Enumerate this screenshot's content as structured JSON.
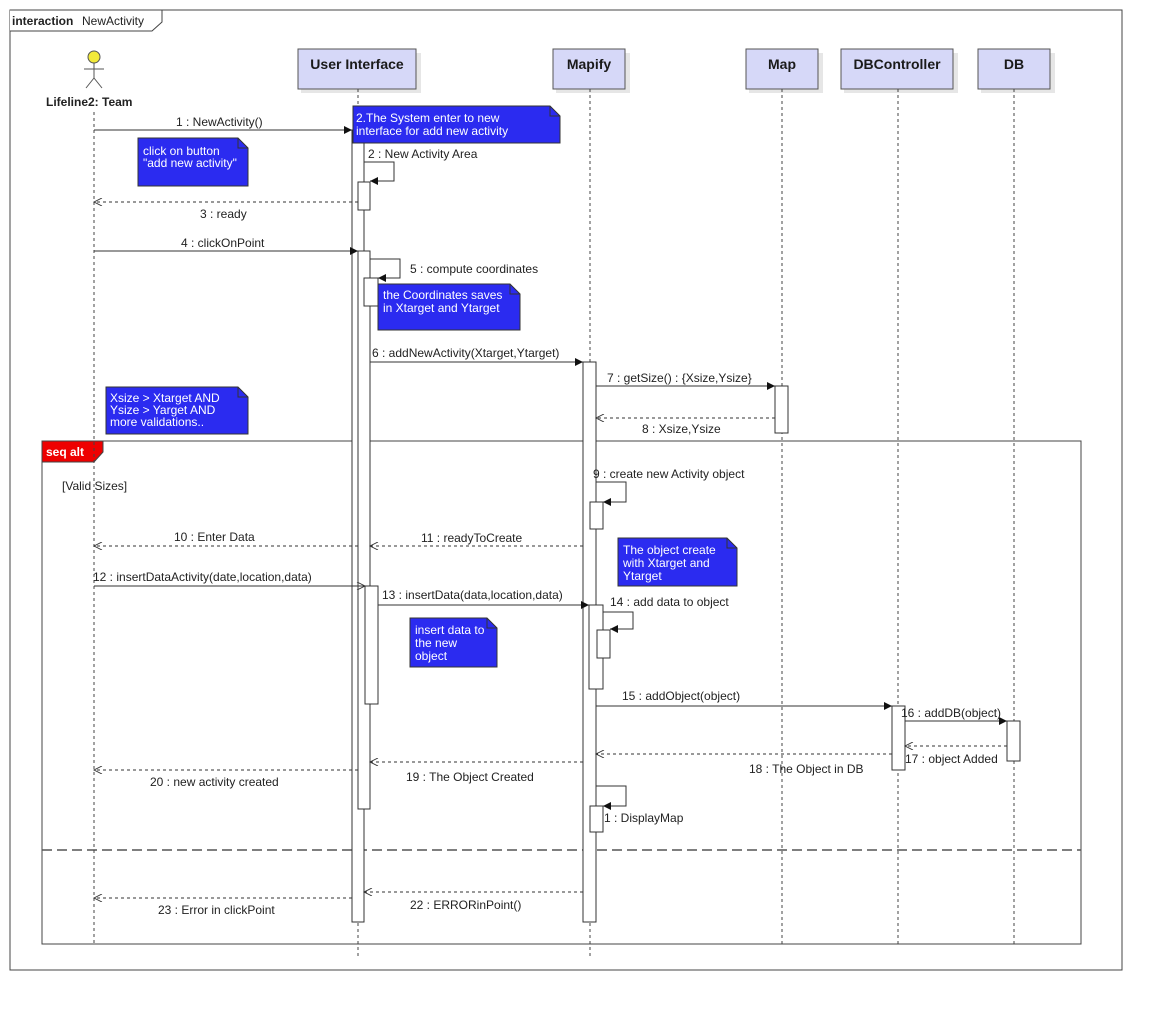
{
  "frame": {
    "keyword": "interaction",
    "name": "NewActivity"
  },
  "actor": {
    "label": "Lifeline2: Team"
  },
  "lifelines": {
    "ui": "User Interface",
    "mapify": "Mapify",
    "map": "Map",
    "dbcontroller": "DBController",
    "db": "DB"
  },
  "fragment": {
    "tag": "seq alt",
    "guard": "[Valid Sizes]"
  },
  "messages": {
    "m1": "1 : NewActivity()",
    "m2": "2 : New Activity Area",
    "m3": "3 : ready",
    "m4": "4 : clickOnPoint",
    "m5": "5 : compute coordinates",
    "m6": "6 : addNewActivity(Xtarget,Ytarget)",
    "m7": "7 : getSize() : {Xsize,Ysize}",
    "m8": "8 : Xsize,Ysize",
    "m9": "9 : create new Activity object",
    "m10": "10 : Enter Data",
    "m11": "11 : readyToCreate",
    "m12": "12 : insertDataActivity(date,location,data)",
    "m13": "13 : insertData(data,location,data)",
    "m14": "14 : add data to object",
    "m15": "15 : addObject(object)",
    "m16": "16 : addDB(object)",
    "m17": "17 : object Added",
    "m18": "18 : The Object in DB",
    "m19": "19 : The Object Created",
    "m20": "20 : new activity created",
    "m21": "1 : DisplayMap",
    "m22": "22 : ERRORinPoint()",
    "m23": "23 : Error in clickPoint"
  },
  "notes": {
    "n1": [
      "2.The System enter to new",
      "interface for add new activity"
    ],
    "n2": [
      "click on button",
      "\"add new activity\""
    ],
    "n3": [
      "the Coordinates saves",
      "in Xtarget and Ytarget"
    ],
    "n4": [
      "Xsize > Xtarget AND",
      "Ysize > Yarget  AND",
      "more validations.."
    ],
    "n5": [
      "The object create",
      "with Xtarget and",
      "Ytarget"
    ],
    "n6": [
      "insert data to",
      "the new",
      "object"
    ]
  },
  "colors": {
    "note_fill": "#2b2bf0",
    "lifeline_head_fill": "#d6d8f8",
    "fragment_tag_fill": "#ee0000",
    "line": "#333333"
  }
}
